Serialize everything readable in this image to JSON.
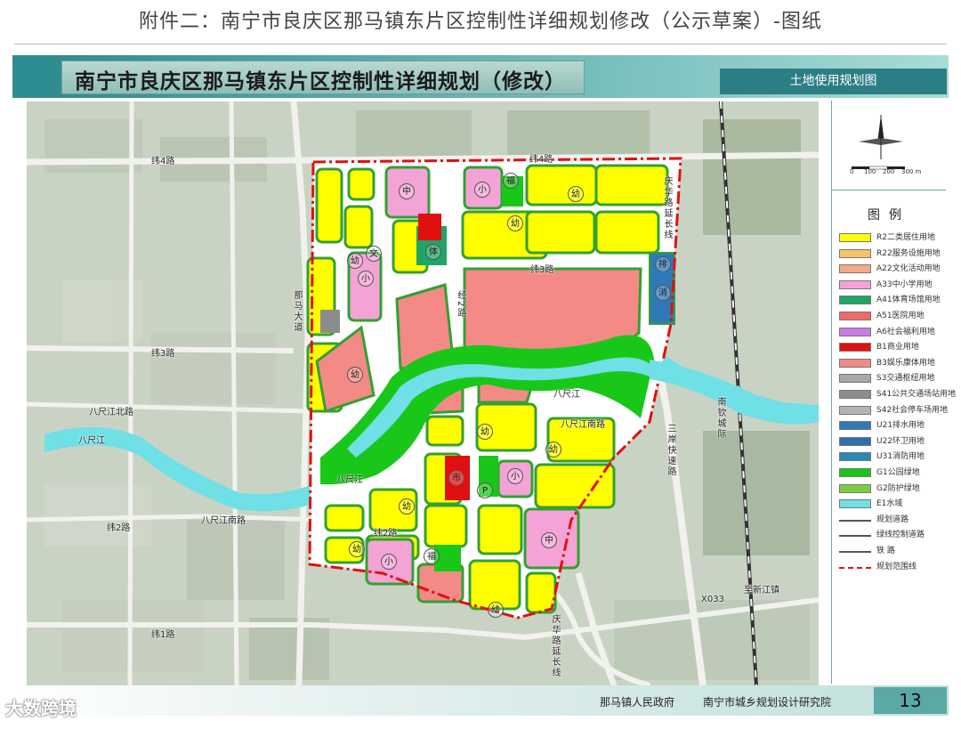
{
  "document_title": "附件二：南宁市良庆区那马镇东片区控制性详细规划修改（公示草案）-图纸",
  "sheet": {
    "banner_title": "南宁市良庆区那马镇东片区控制性详细规划（修改）",
    "drawing_name": "土地使用规划图"
  },
  "compass": {
    "scale_labels": [
      "0",
      "100",
      "200",
      "300 m"
    ]
  },
  "legend": {
    "heading": "图例",
    "items": [
      {
        "label": "R2二类居住用地",
        "color": "#ffff00"
      },
      {
        "label": "R22服务设施用地",
        "color": "#f5c36a"
      },
      {
        "label": "A22文化活动用地",
        "color": "#f4a985"
      },
      {
        "label": "A33中小学用地",
        "color": "#f3a3d6"
      },
      {
        "label": "A41体育场馆用地",
        "color": "#20a468"
      },
      {
        "label": "A51医院用地",
        "color": "#f06a6a"
      },
      {
        "label": "A6社会福利用地",
        "color": "#c77ce6"
      },
      {
        "label": "B1商业用地",
        "color": "#e01010"
      },
      {
        "label": "B3娱乐康体用地",
        "color": "#f38a86"
      },
      {
        "label": "S3交通枢纽用地",
        "color": "#a8a8a8"
      },
      {
        "label": "S41公共交通场站用地",
        "color": "#8c8c8c"
      },
      {
        "label": "S42社会停车场用地",
        "color": "#b3b3b3"
      },
      {
        "label": "U21排水用地",
        "color": "#2f79b8"
      },
      {
        "label": "U22环卫用地",
        "color": "#2f6fb0"
      },
      {
        "label": "U31消防用地",
        "color": "#2a88b8"
      },
      {
        "label": "G1公园绿地",
        "color": "#19c719"
      },
      {
        "label": "G2防护绿地",
        "color": "#7ccf3c"
      },
      {
        "label": "E1水域",
        "color": "#6fe0e6"
      },
      {
        "label": "规划道路",
        "color": "#ffffff"
      },
      {
        "label": "绿线控制道路",
        "color": "#ffffff"
      },
      {
        "label": "铁    路",
        "color": "#ffffff"
      },
      {
        "label": "规划范围线",
        "color": "#ffffff"
      }
    ]
  },
  "map_labels": {
    "road_wei4": "纬4路",
    "road_wei3": "纬3路",
    "road_wei3_left": "纬3路",
    "road_wei2": "纬2路",
    "road_wei2_left": "纬2路",
    "road_wei1": "纬1路",
    "road_nama": "那马大道",
    "road_jing2": "经2路",
    "road_qinghua_n": "庆华路延长线",
    "road_qinghua_s": "庆华路延长线",
    "road_bachi_n": "八尺江北路",
    "road_bachi_s": "八尺江南路",
    "road_bachi_s2": "八尺江南路",
    "road_x033": "X033",
    "road_to_xinjiang": "至新江镇",
    "road_highway": "三岸快速路",
    "rail_nantie": "南钦城际",
    "river_west": "八尺江",
    "river_center": "八尺江",
    "river_east": "八尺江"
  },
  "symbols": {
    "school": "小",
    "middle_school": "中",
    "kindergarten": "幼",
    "culture": "文",
    "welfare": "福",
    "sports": "体",
    "parking": "P",
    "water": "排",
    "fire": "消",
    "market": "市"
  },
  "footer": {
    "org_a": "那马镇人民政府",
    "org_b": "南宁市城乡规划设计研究院",
    "page": "13"
  },
  "watermark": "大数跨境"
}
